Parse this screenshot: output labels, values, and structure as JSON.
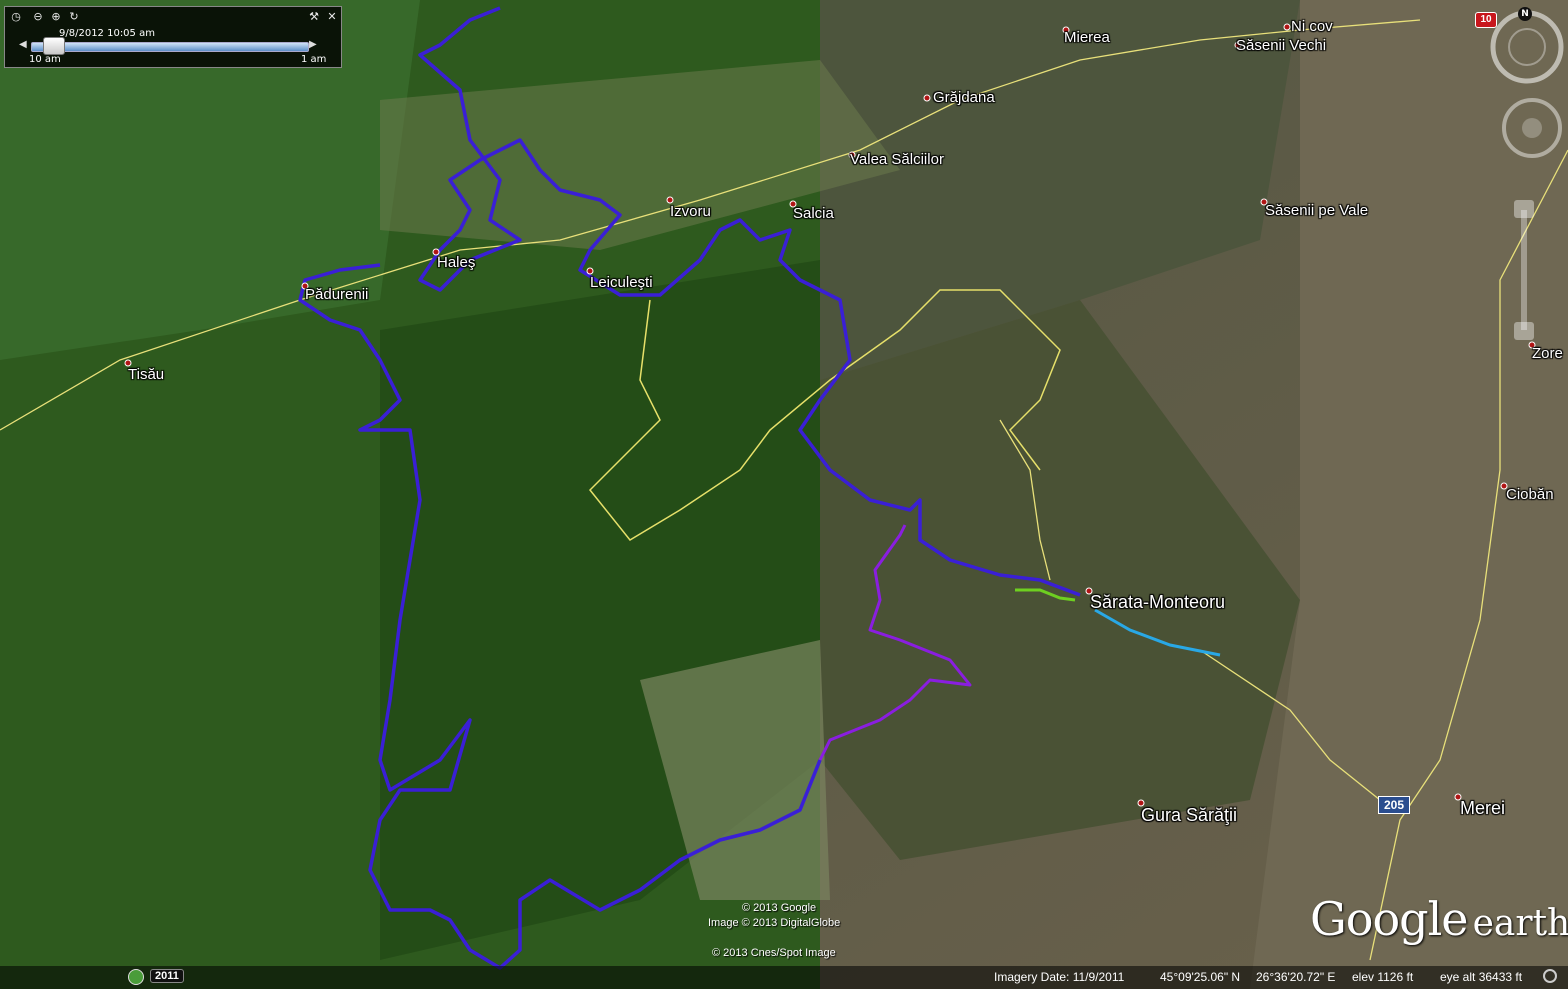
{
  "time_slider": {
    "date_time": "9/8/2012  10:05 am",
    "range_start": "10 am",
    "range_end": "1 am"
  },
  "navigation": {
    "north_label": "N"
  },
  "places": [
    {
      "id": "nicov",
      "label": "Ni   cov"
    },
    {
      "id": "sasenii-vechi",
      "label": "Săsenii Vechi"
    },
    {
      "id": "mierea",
      "label": "Mierea"
    },
    {
      "id": "grajdana",
      "label": "Grăjdana"
    },
    {
      "id": "valea-salciilor",
      "label": "Valea Sălciilor"
    },
    {
      "id": "izvoru",
      "label": "Izvoru"
    },
    {
      "id": "salcia",
      "label": "Salcia"
    },
    {
      "id": "sasenii-pe-vale",
      "label": "Săsenii pe Vale"
    },
    {
      "id": "hales",
      "label": "Haleş"
    },
    {
      "id": "padurenii",
      "label": "Pădurenii"
    },
    {
      "id": "leiculesti",
      "label": "Leiculeşti"
    },
    {
      "id": "tisau",
      "label": "Tisău"
    },
    {
      "id": "zore",
      "label": "Zore"
    },
    {
      "id": "cioban",
      "label": "Ciobăn"
    },
    {
      "id": "sarata-monteoru",
      "label": "Sărata-Monteoru"
    },
    {
      "id": "gura-saratii",
      "label": "Gura Sărăţii"
    },
    {
      "id": "merei",
      "label": "Merei"
    }
  ],
  "road_shields": {
    "red": "10",
    "blue": "205"
  },
  "copyright": {
    "line1": "© 2013 Google",
    "line2": "Image © 2013 DigitalGlobe",
    "line3": "© 2013 Cnes/Spot Image"
  },
  "logo": {
    "google": "Google",
    "earth": "earth"
  },
  "status_bar": {
    "year": "2011",
    "imagery_date": "Imagery Date: 11/9/2011",
    "lat": "45°09'25.06\" N",
    "lon": "26°36'20.72\" E",
    "elev": "elev  1126 ft",
    "eye_alt": "eye alt  36433 ft"
  },
  "colors": {
    "forest": "#2f5a1f",
    "dark_forest": "#1f4414",
    "terrain": "#5b5a45",
    "track_blue": "#3a1fd6",
    "track_purple": "#8a1ee0",
    "track_yellow": "#e6e06a",
    "track_green": "#6ed020",
    "track_cyan": "#29a8e6",
    "road": "#e8e07a"
  }
}
